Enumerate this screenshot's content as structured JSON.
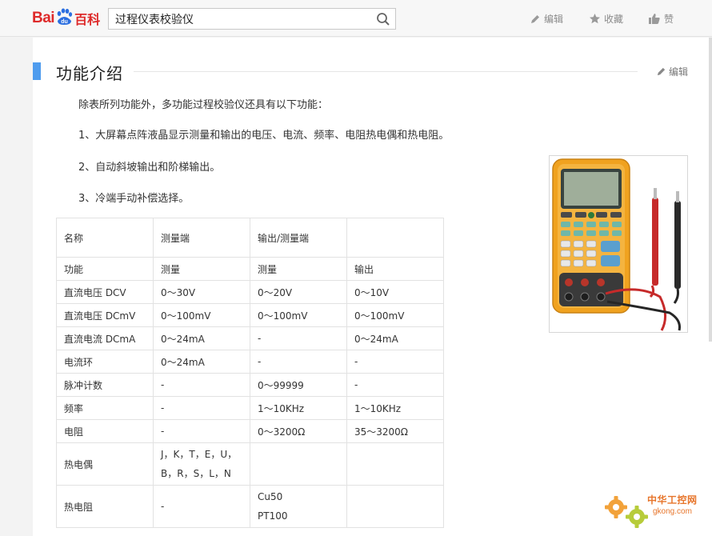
{
  "header": {
    "logo_text_bai": "Bai",
    "logo_text_du": "du",
    "logo_text_baike": "百科",
    "search_value": "过程仪表校验仪",
    "actions": [
      {
        "label": "编辑",
        "icon": "pencil-icon"
      },
      {
        "label": "收藏",
        "icon": "star-icon"
      },
      {
        "label": "赞",
        "icon": "thumbs-up-icon"
      }
    ]
  },
  "section": {
    "title": "功能介绍",
    "edit_label": "编辑",
    "intro": "除表所列功能外，多功能过程校验仪还具有以下功能：",
    "items": [
      "1、大屏幕点阵液晶显示测量和输出的电压、电流、频率、电阻热电偶和热电阻。",
      "2、自动斜坡输出和阶梯输出。",
      "3、冷端手动补偿选择。"
    ]
  },
  "table": {
    "header": [
      "名称",
      "测量端",
      "输出/测量端",
      ""
    ],
    "subheader": [
      "功能",
      "测量",
      "测量",
      "输出"
    ],
    "rows": [
      [
        "直流电压 DCV",
        "0～30V",
        "0～20V",
        "0～10V"
      ],
      [
        "直流电压 DCmV",
        "0～100mV",
        "0～100mV",
        "0～100mV"
      ],
      [
        "直流电流 DCmA",
        "0～24mA",
        "-",
        "0～24mA"
      ],
      [
        "电流环",
        "0～24mA",
        "-",
        "-"
      ],
      [
        "脉冲计数",
        "-",
        "0～99999",
        "-"
      ],
      [
        "频率",
        "-",
        "1～10KHz",
        "1～10KHz"
      ],
      [
        "电阻",
        "-",
        "0～3200Ω",
        "35～3200Ω"
      ]
    ],
    "thermocouple": {
      "name": "热电偶",
      "line1": "J，K，T，E，U，",
      "line2": "B，R，S，L，N"
    },
    "rtd": {
      "name": "热电阻",
      "col2": "-",
      "line1": "Cu50",
      "line2": "PT100"
    }
  },
  "watermark": {
    "title": "中华工控网",
    "url": "gkong.com"
  },
  "colors": {
    "brand_red": "#de2a2a",
    "brand_blue": "#2c6fe0",
    "accent_bar": "#4f9cee",
    "watermark": "#e7752b"
  }
}
